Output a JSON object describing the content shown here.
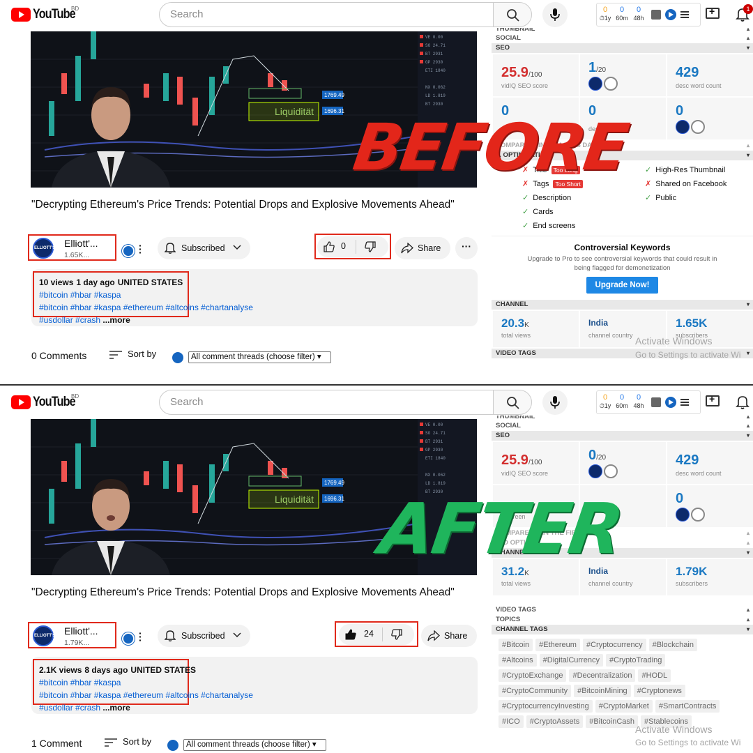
{
  "labels": {
    "before": "BEFORE",
    "after": "AFTER"
  },
  "youtube": {
    "logo": "YouTube",
    "region": "BD",
    "search_placeholder": "Search"
  },
  "before": {
    "header": {
      "stat1": "0",
      "stat1_label": "1y",
      "stat2": "0",
      "stat2_label": "60m",
      "stat3": "0",
      "stat3_label": "48h",
      "notifications": "1"
    },
    "video": {
      "title": "\"Decrypting Ethereum's Price Trends: Potential Drops and Explosive Movements Ahead\"",
      "overlay_text": "Liquidität",
      "price_tag1": "1769.49",
      "price_tag2": "1696.31"
    },
    "channel": {
      "name": "Elliott'...",
      "subs": "1.65K...",
      "avatar_text": "ELLIOTT'S"
    },
    "buttons": {
      "subscribed": "Subscribed",
      "likes": "0",
      "share": "Share"
    },
    "description": {
      "views": "10 views",
      "age": "1 day ago",
      "location": "UNITED STATES",
      "line1": "#bitcoin #hbar #kaspa",
      "line2": "#bitcoin #hbar #kaspa #ethereum #altcoins #chartanalyse",
      "line3": "#usdollar #crash",
      "more": "...more"
    },
    "comments": {
      "count": "0 Comments",
      "sort": "Sort by",
      "filter": "All comment threads (choose filter)"
    },
    "vidiq": {
      "thumbnail_header": "THUMBNAIL",
      "social_header": "SOCIAL",
      "seo_header": "SEO",
      "seo_score": "25.9",
      "seo_max": "/100",
      "seo_label": "vidIQ SEO score",
      "stat2": "1",
      "stat2_max": "/20",
      "desc_words": "429",
      "desc_words_label": "desc word count",
      "stat4": "0",
      "stat5": "0",
      "stat5_label": "desc link count",
      "stat6": "0",
      "compare_header": "COMPARE ... IN ... LAST 28 DAYS",
      "optimization_header": "... OPTIMIZATION",
      "checks": {
        "title": "Title",
        "title_badge": "Too Long",
        "tags": "Tags",
        "tags_badge": "Too Short",
        "description": "Description",
        "cards": "Cards",
        "end_screens": "End screens",
        "thumbnail": "High-Res Thumbnail",
        "facebook": "Shared on Facebook",
        "public": "Public"
      },
      "controversial_title": "Controversial Keywords",
      "controversial_text": "Upgrade to Pro to see controversial keywords that could result in being flagged for demonetization",
      "upgrade": "Upgrade Now!",
      "channel_header": "CHANNEL",
      "total_views": "20.3",
      "total_views_unit": "K",
      "total_views_label": "total views",
      "country": "India",
      "country_label": "channel country",
      "subscribers": "1.65K",
      "subscribers_label": "subscribers",
      "video_tags_header": "VIDEO TAGS"
    },
    "watermark": {
      "line1": "Activate Windows",
      "line2": "Go to Settings to activate Wi"
    }
  },
  "after": {
    "header": {
      "stat1": "0",
      "stat1_label": "1y",
      "stat2": "0",
      "stat2_label": "60m",
      "stat3": "0",
      "stat3_label": "48h"
    },
    "video": {
      "title": "\"Decrypting Ethereum's Price Trends: Potential Drops and Explosive Movements Ahead\"",
      "overlay_text": "Liquidität",
      "price_tag1": "1769.49",
      "price_tag2": "1696.31"
    },
    "channel": {
      "name": "Elliott'...",
      "subs": "1.79K...",
      "avatar_text": "ELLIOTT'S"
    },
    "buttons": {
      "subscribed": "Subscribed",
      "likes": "24",
      "share": "Share"
    },
    "description": {
      "views": "2.1K views",
      "age": "8 days ago",
      "location": "UNITED STATES",
      "line1": "#bitcoin #hbar #kaspa",
      "line2": "#bitcoin #hbar #kaspa #ethereum #altcoins #chartanalyse",
      "line3": "#usdollar #crash",
      "more": "...more"
    },
    "comments": {
      "count": "1 Comment",
      "sort": "Sort by",
      "filter": "All comment threads (choose filter)"
    },
    "vidiq": {
      "thumbnail_header": "THUMBNAIL",
      "social_header": "SOCIAL",
      "seo_header": "SEO",
      "seo_score": "25.9",
      "seo_max": "/100",
      "seo_label": "vidIQ SEO score",
      "stat2": "0",
      "stat2_max": "/20",
      "desc_words": "429",
      "desc_words_label": "desc word count",
      "stat4": "0",
      "stat5_label": "...screen",
      "compare_header": "COMPARE V... IN THE FIR... 8",
      "optimization_header": "... O OPTI...",
      "channel_header": "CHANNEL",
      "total_views": "31.2",
      "total_views_unit": "K",
      "total_views_label": "total views",
      "country": "India",
      "country_label": "channel country",
      "subscribers": "1.79K",
      "subscribers_label": "subscribers",
      "video_tags_header": "VIDEO TAGS",
      "topics_header": "TOPICS",
      "channel_tags_header": "CHANNEL TAGS",
      "tags": [
        "#Bitcoin",
        "#Ethereum",
        "#Cryptocurrency",
        "#Blockchain",
        "#Altcoins",
        "#DigitalCurrency",
        "#CryptoTrading",
        "#CryptoExchange",
        "#Decentralization",
        "#HODL",
        "#CryptoCommunity",
        "#BitcoinMining",
        "#Cryptonews",
        "#CryptocurrencyInvesting",
        "#CryptoMarket",
        "#SmartContracts",
        "#ICO",
        "#CryptoAssets",
        "#BitcoinCash",
        "#Stablecoins"
      ]
    },
    "watermark": {
      "line1": "Activate Windows",
      "line2": "Go to Settings to activate Wi"
    }
  },
  "colors": {
    "accent_red": "#e0291b",
    "before_label": "#e3261a",
    "after_label": "#1fb55c",
    "link_blue": "#065fd4",
    "vidiq_blue": "#1a78c2"
  }
}
